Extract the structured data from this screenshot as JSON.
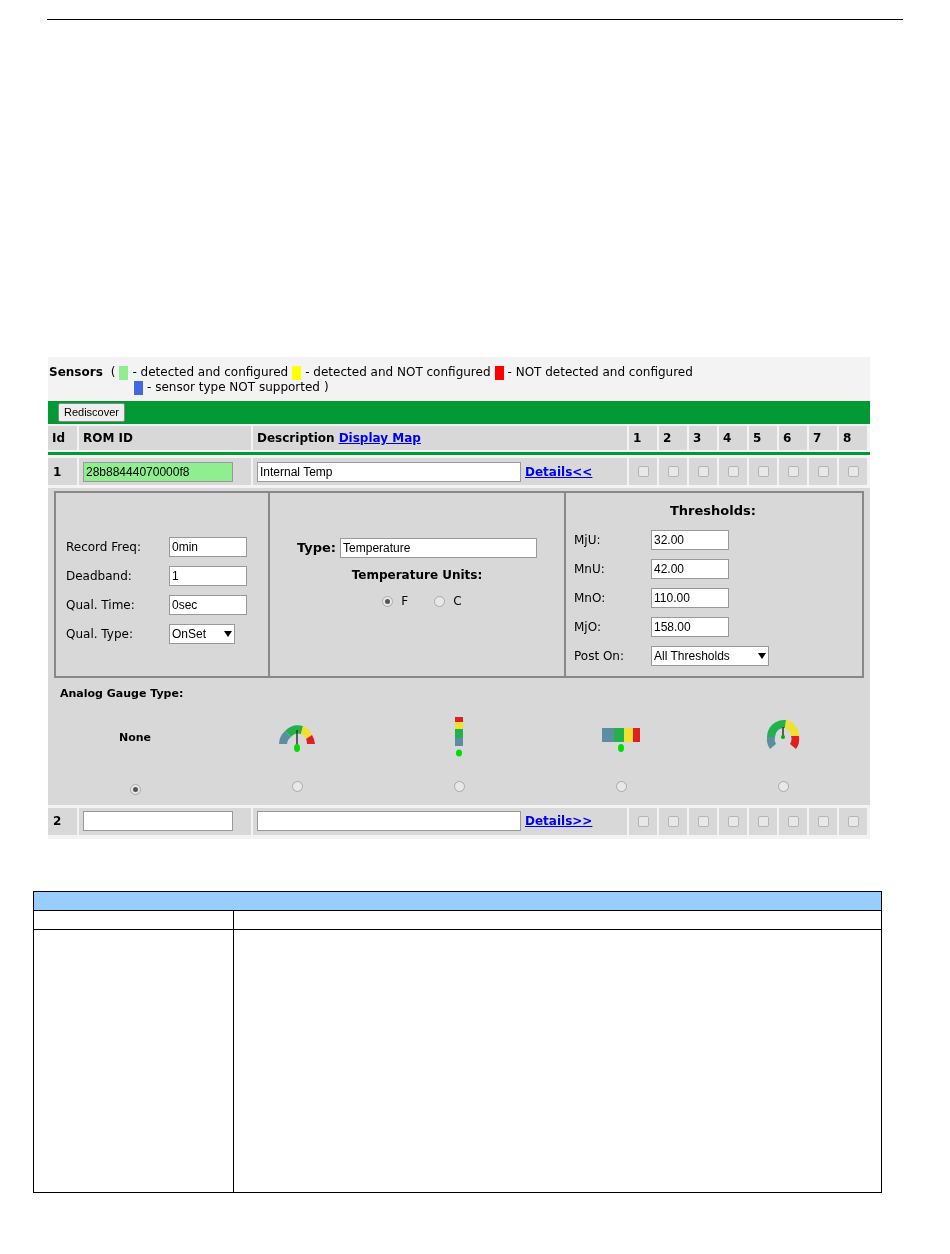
{
  "sensors_panel": {
    "title": "Sensors",
    "legend_open": "(",
    "legend_close": ")",
    "legend": [
      {
        "color": "#90ee90",
        "label": "- detected and configured"
      },
      {
        "color": "#ffff00",
        "label": "- detected and NOT configured"
      },
      {
        "color": "#ff0000",
        "label": "- NOT detected and configured"
      },
      {
        "color": "#4169e1",
        "label": "- sensor type NOT supported"
      }
    ],
    "rediscover_button": "Rediscover",
    "columns": {
      "id": "Id",
      "rom_id": "ROM ID",
      "description": "Description",
      "display_map_link": "Display Map",
      "outputs": [
        "1",
        "2",
        "3",
        "4",
        "5",
        "6",
        "7",
        "8"
      ]
    },
    "rows": [
      {
        "id": "1",
        "rom_id": "28b88444070000f8",
        "color": "#90ee90",
        "description": "Internal Temp",
        "details_link": "Details<<",
        "expanded": true,
        "outputs": [
          {
            "checked": false
          },
          {
            "checked": false
          },
          {
            "checked": false
          },
          {
            "checked": false
          },
          {
            "checked": false
          },
          {
            "checked": false
          },
          {
            "checked": false
          },
          {
            "checked": false
          }
        ]
      },
      {
        "id": "2",
        "details_link": "Details>>",
        "expanded": false,
        "outputs": [
          {
            "checked": false
          },
          {
            "checked": false
          },
          {
            "checked": false
          },
          {
            "checked": false
          },
          {
            "checked": false
          },
          {
            "checked": false
          },
          {
            "checked": false
          },
          {
            "checked": false
          }
        ]
      }
    ],
    "details": {
      "settings": [
        {
          "label": "Record Freq:",
          "value": "0min",
          "kind": "text"
        },
        {
          "label": "Deadband:",
          "value": "1",
          "kind": "text"
        },
        {
          "label": "Qual. Time:",
          "value": "0sec",
          "kind": "text"
        },
        {
          "label": "Qual. Type:",
          "value": "OnSet",
          "kind": "select"
        }
      ],
      "type_label": "Type:",
      "type_value": "Temperature",
      "units_label": "Temperature Units:",
      "units": [
        {
          "label": "F",
          "selected": true
        },
        {
          "label": "C",
          "selected": false
        }
      ],
      "thresholds_title": "Thresholds:",
      "thresholds": [
        {
          "label": "MjU:",
          "value": "32.00",
          "kind": "text"
        },
        {
          "label": "MnU:",
          "value": "42.00",
          "kind": "text"
        },
        {
          "label": "MnO:",
          "value": "110.00",
          "kind": "text"
        },
        {
          "label": "MjO:",
          "value": "158.00",
          "kind": "text"
        },
        {
          "label": "Post On:",
          "value": "All Thresholds",
          "kind": "select"
        }
      ],
      "gauge_title": "Analog Gauge Type:",
      "gauges": [
        {
          "kind": "none",
          "label": "None",
          "selected": true
        },
        {
          "kind": "semicircle",
          "selected": false
        },
        {
          "kind": "vertical",
          "selected": false
        },
        {
          "kind": "horizontal",
          "selected": false
        },
        {
          "kind": "dial",
          "selected": false
        }
      ]
    }
  }
}
